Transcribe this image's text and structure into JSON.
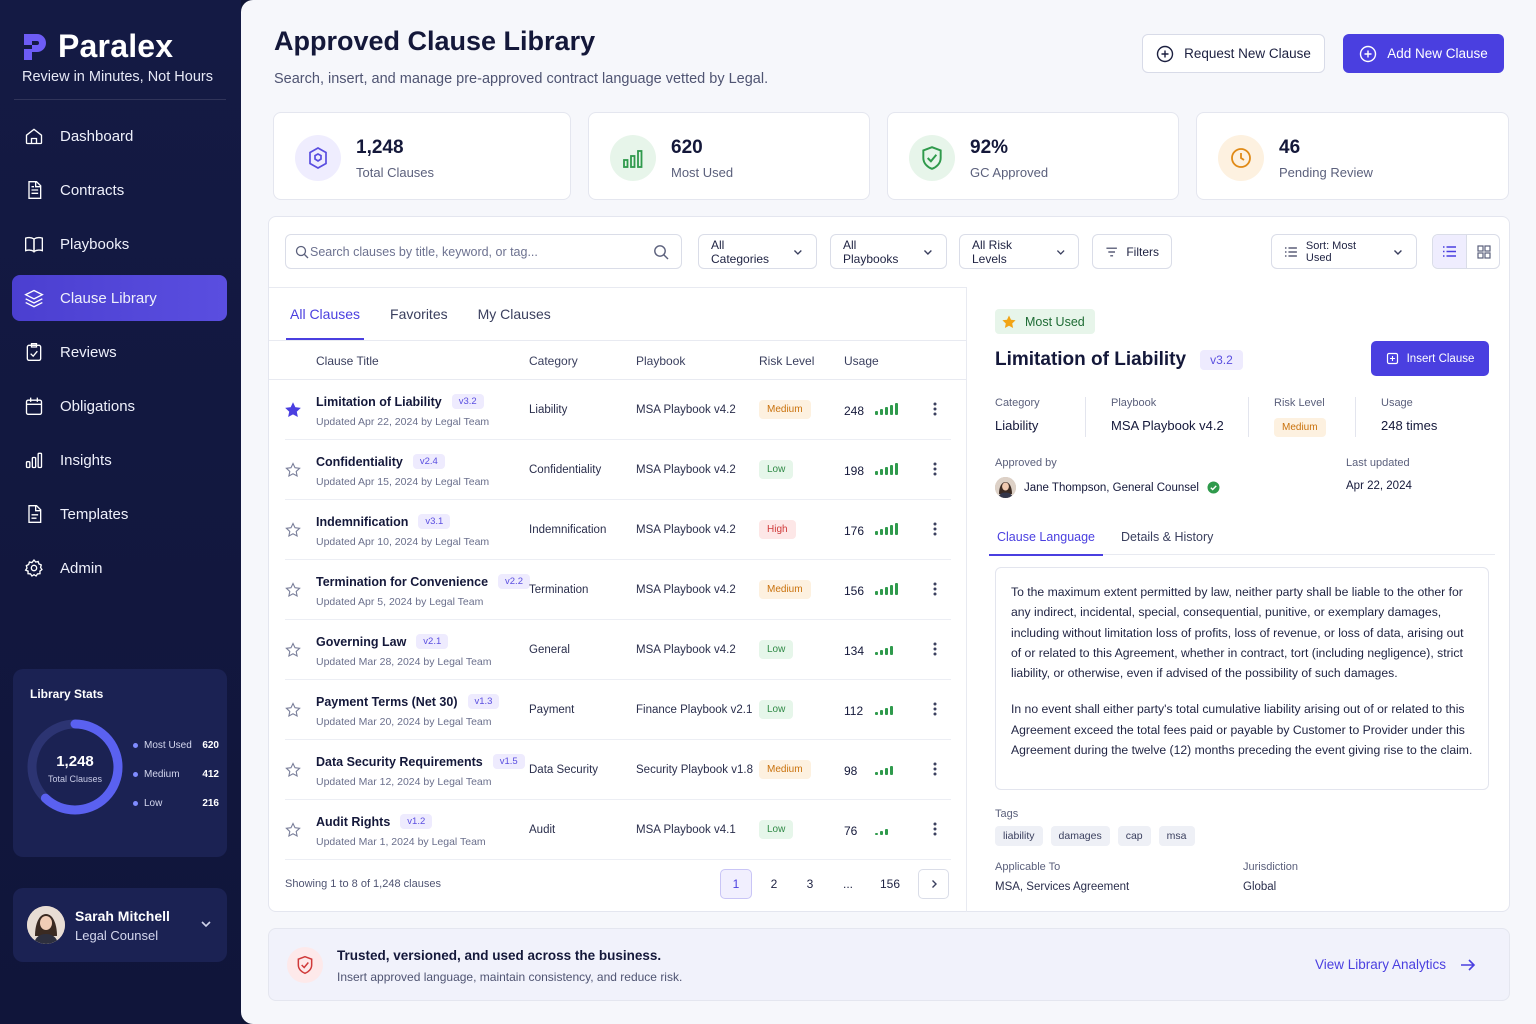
{
  "brand": {
    "name": "Paralex",
    "tagline": "Review in Minutes, Not Hours"
  },
  "nav": [
    {
      "label": "Dashboard",
      "icon": "home-icon"
    },
    {
      "label": "Contracts",
      "icon": "document-icon"
    },
    {
      "label": "Playbooks",
      "icon": "book-icon"
    },
    {
      "label": "Clause Library",
      "icon": "layers-icon",
      "active": true
    },
    {
      "label": "Reviews",
      "icon": "checklist-icon"
    },
    {
      "label": "Obligations",
      "icon": "calendar-icon"
    },
    {
      "label": "Insights",
      "icon": "bar-chart-icon"
    },
    {
      "label": "Templates",
      "icon": "template-icon"
    },
    {
      "label": "Admin",
      "icon": "gear-icon"
    }
  ],
  "library_stats": {
    "title": "Library Stats",
    "total": "1,248",
    "total_label": "Total Clauses",
    "legend": [
      {
        "label": "Most Used",
        "value": "620"
      },
      {
        "label": "Medium",
        "value": "412"
      },
      {
        "label": "Low",
        "value": "216"
      }
    ]
  },
  "user": {
    "name": "Sarah Mitchell",
    "role": "Legal Counsel"
  },
  "header": {
    "title": "Approved Clause Library",
    "subtitle": "Search, insert, and manage pre-approved contract language vetted by Legal.",
    "request_label": "Request New Clause",
    "add_label": "Add New Clause"
  },
  "kpis": [
    {
      "value": "1,248",
      "label": "Total Clauses",
      "icon": "shield-hex-icon"
    },
    {
      "value": "620",
      "label": "Most Used",
      "icon": "bar-chart-icon"
    },
    {
      "value": "92%",
      "label": "GC Approved",
      "icon": "shield-check-icon"
    },
    {
      "value": "46",
      "label": "Pending Review",
      "icon": "clock-icon"
    }
  ],
  "filters": {
    "search_placeholder": "Search clauses by title, keyword, or tag...",
    "categories": "All Categories",
    "playbooks": "All Playbooks",
    "risk": "All Risk Levels",
    "filters": "Filters",
    "sort": "Sort: Most Used"
  },
  "tabs": [
    "All Clauses",
    "Favorites",
    "My Clauses"
  ],
  "columns": {
    "title": "Clause Title",
    "category": "Category",
    "playbook": "Playbook",
    "risk": "Risk Level",
    "usage": "Usage"
  },
  "clauses": [
    {
      "title": "Limitation of Liability",
      "version": "v3.2",
      "updated": "Updated Apr 22, 2024 by Legal Team",
      "category": "Liability",
      "playbook": "MSA Playbook v4.2",
      "risk": "Medium",
      "usage": "248",
      "favorite": true
    },
    {
      "title": "Confidentiality",
      "version": "v2.4",
      "updated": "Updated Apr 15, 2024 by Legal Team",
      "category": "Confidentiality",
      "playbook": "MSA Playbook v4.2",
      "risk": "Low",
      "usage": "198",
      "favorite": false
    },
    {
      "title": "Indemnification",
      "version": "v3.1",
      "updated": "Updated Apr 10, 2024 by Legal Team",
      "category": "Indemnification",
      "playbook": "MSA Playbook v4.2",
      "risk": "High",
      "usage": "176",
      "favorite": false
    },
    {
      "title": "Termination for Convenience",
      "version": "v2.2",
      "updated": "Updated Apr 5, 2024 by Legal Team",
      "category": "Termination",
      "playbook": "MSA Playbook v4.2",
      "risk": "Medium",
      "usage": "156",
      "favorite": false
    },
    {
      "title": "Governing Law",
      "version": "v2.1",
      "updated": "Updated Mar 28, 2024 by Legal Team",
      "category": "General",
      "playbook": "MSA Playbook v4.2",
      "risk": "Low",
      "usage": "134",
      "favorite": false
    },
    {
      "title": "Payment Terms (Net 30)",
      "version": "v1.3",
      "updated": "Updated Mar 20, 2024 by Legal Team",
      "category": "Payment",
      "playbook": "Finance Playbook v2.1",
      "risk": "Low",
      "usage": "112",
      "favorite": false
    },
    {
      "title": "Data Security Requirements",
      "version": "v1.5",
      "updated": "Updated Mar 12, 2024 by Legal Team",
      "category": "Data Security",
      "playbook": "Security Playbook v1.8",
      "risk": "Medium",
      "usage": "98",
      "favorite": false
    },
    {
      "title": "Audit Rights",
      "version": "v1.2",
      "updated": "Updated Mar 1, 2024 by Legal Team",
      "category": "Audit",
      "playbook": "MSA Playbook v4.1",
      "risk": "Low",
      "usage": "76",
      "favorite": false
    }
  ],
  "pagination": {
    "showing": "Showing 1 to 8 of 1,248 clauses",
    "pages": [
      "1",
      "2",
      "3",
      "...",
      "156"
    ],
    "current": "1"
  },
  "detail": {
    "badge": "Most Used",
    "title": "Limitation of Liability",
    "version": "v3.2",
    "insert_label": "Insert Clause",
    "meta": [
      {
        "k": "Category",
        "v": "Liability"
      },
      {
        "k": "Playbook",
        "v": "MSA Playbook v4.2"
      },
      {
        "k": "Risk Level",
        "v": "Medium"
      },
      {
        "k": "Usage",
        "v": "248 times"
      }
    ],
    "approved_by_label": "Approved by",
    "approved_by": "Jane Thompson, General Counsel",
    "last_updated_label": "Last updated",
    "last_updated": "Apr 22, 2024",
    "tabs": [
      "Clause Language",
      "Details & History"
    ],
    "language": [
      "To the maximum extent permitted by law, neither party shall be liable to the other for any indirect, incidental, special, consequential, punitive, or exemplary damages, including without limitation loss of profits, loss of revenue, or loss of data, arising out of or related to this Agreement, whether in contract, tort (including negligence), strict liability, or otherwise, even if advised of the possibility of such damages.",
      "In no event shall either party's total cumulative liability arising out of or related to this Agreement exceed the total fees paid or payable by Customer to Provider under this Agreement during the twelve (12) months preceding the event giving rise to the claim."
    ],
    "tags_label": "Tags",
    "tags": [
      "liability",
      "damages",
      "cap",
      "msa"
    ],
    "applicable_label": "Applicable To",
    "applicable": "MSA, Services Agreement",
    "jurisdiction_label": "Jurisdiction",
    "jurisdiction": "Global"
  },
  "banner": {
    "title": "Trusted, versioned, and used across the business.",
    "subtitle": "Insert approved language, maintain consistency, and reduce risk.",
    "link": "View Library Analytics"
  },
  "colors": {
    "accent": "#4a3fe0",
    "sidebar": "#141a44",
    "success": "#2f9a4c",
    "warning": "#c9710b",
    "danger": "#d03a3a"
  }
}
